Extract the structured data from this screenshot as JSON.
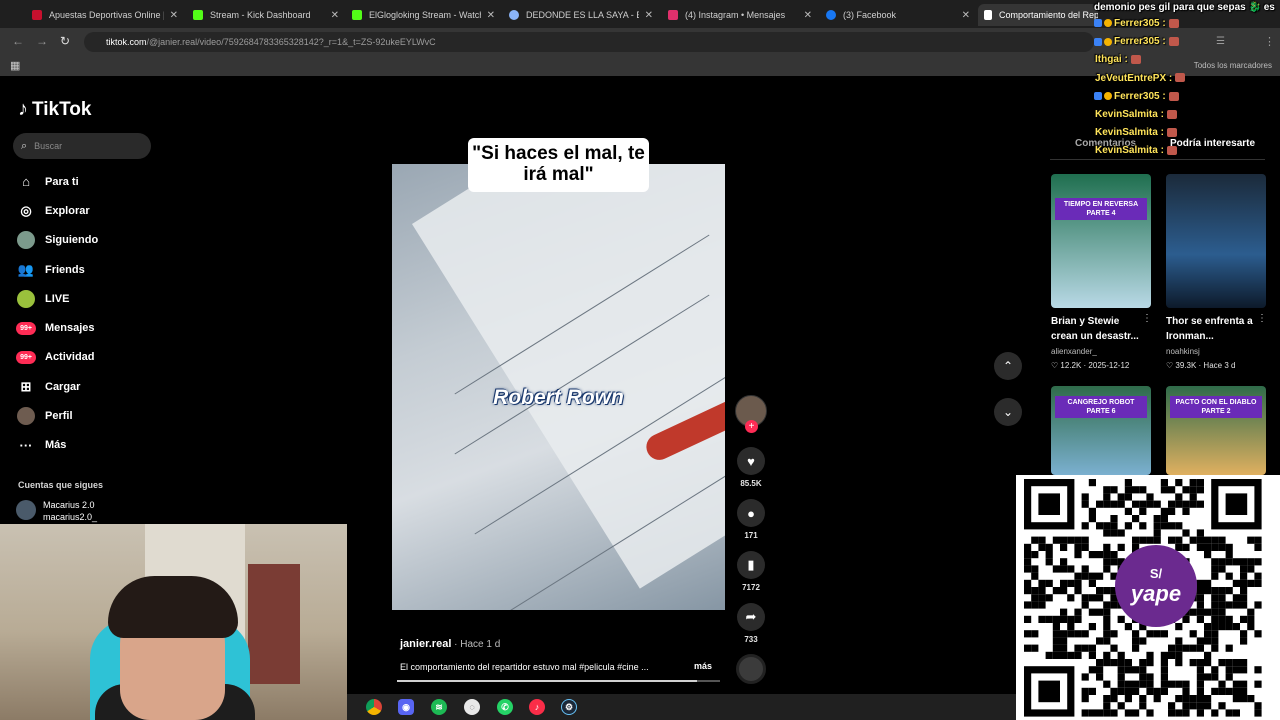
{
  "browser": {
    "tabs": [
      {
        "title": "Apuestas Deportivas Online | Apuestas",
        "color": "#c8102e"
      },
      {
        "title": "Stream - Kick Dashboard",
        "color": "#53fc18"
      },
      {
        "title": "ElGlogloking Stream - Watch Live",
        "color": "#53fc18"
      },
      {
        "title": "DEDONDE ES LLA SAYA - Buscar con Google",
        "color": "#8ab4f8"
      },
      {
        "title": "(4) Instagram • Mensajes",
        "color": "#e1306c"
      },
      {
        "title": "(3) Facebook",
        "color": "#1877f2"
      },
      {
        "title": "Comportamiento del Repartidor",
        "color": "#ffffff"
      }
    ],
    "url_host": "tiktok.com",
    "url_path": "/@janier.real/video/7592684783365328142?_r=1&_t=ZS-92ukeEYLWvC",
    "bookmarks_label": "Todos los marcadores"
  },
  "sidebar": {
    "logo": "TikTok",
    "search_placeholder": "Buscar",
    "items": [
      {
        "label": "Para ti",
        "icon": "home-icon"
      },
      {
        "label": "Explorar",
        "icon": "compass-icon"
      },
      {
        "label": "Siguiendo",
        "icon": "following-avatar"
      },
      {
        "label": "Friends",
        "icon": "friends-icon"
      },
      {
        "label": "LIVE",
        "icon": "live-icon"
      },
      {
        "label": "Mensajes",
        "icon": "messages-badge",
        "badge": "99+"
      },
      {
        "label": "Actividad",
        "icon": "activity-badge",
        "badge": "99+"
      },
      {
        "label": "Cargar",
        "icon": "upload-icon"
      },
      {
        "label": "Perfil",
        "icon": "profile-icon"
      },
      {
        "label": "Más",
        "icon": "more-icon"
      }
    ],
    "following_heading": "Cuentas que sigues",
    "following": [
      {
        "name": "Macarius 2.0",
        "handle": "macarius2.0_"
      }
    ]
  },
  "video": {
    "caption": "\"Si haces el mal, te irá mal\"",
    "name_overlay": "Robert Rown",
    "author": "janier.real",
    "posted": "Hace 1 d",
    "description": "El comportamiento del repartidor estuvo mal #pelicula #cine ...",
    "more_label": "más",
    "likes": "85.5K",
    "comments": "171",
    "saves": "7172",
    "shares": "733",
    "progress": 0.93
  },
  "right_panel": {
    "tabs": [
      "Comentarios",
      "Podría interesarte"
    ],
    "cards": [
      {
        "title": "Brian y Stewie crean un desastr...",
        "user": "alienxander_",
        "likes": "12.2K",
        "date": "2025-12-12",
        "tag": "TIEMPO EN REVERSA PARTE 4"
      },
      {
        "title": "Thor se enfrenta a Ironman...",
        "user": "noahkinsj",
        "likes": "39.3K",
        "date": "Hace 3 d",
        "tag": ""
      },
      {
        "title": "",
        "user": "",
        "likes": "",
        "date": "",
        "tag": "CANGREJO ROBOT PARTE 6"
      },
      {
        "title": "",
        "user": "",
        "likes": "",
        "date": "",
        "tag": "PACTO CON EL DIABLO PARTE 2"
      }
    ]
  },
  "chat": {
    "top_message": "demonio pes gil para que sepas 🐉 es",
    "lines": [
      {
        "user": "Ferrer305 :",
        "yellow": true
      },
      {
        "user": "Ferrer305 :",
        "yellow": true
      },
      {
        "user": "Ithgai :",
        "yellow": true
      },
      {
        "user": "JeVeutEntrePX :",
        "yellow": true
      },
      {
        "user": "Ferrer305 :",
        "yellow": true
      },
      {
        "user": "KevinSalmita :",
        "yellow": true
      },
      {
        "user": "KevinSalmita :",
        "yellow": true
      },
      {
        "user": "KevinSalmita :",
        "yellow": true
      }
    ]
  },
  "qr": {
    "brand": "yape",
    "brand_mark": "S/"
  },
  "taskbar": {
    "apps": [
      "chrome-icon",
      "discord-icon",
      "spotify-icon",
      "obs-icon",
      "whatsapp-icon",
      "music-icon",
      "steam-icon"
    ]
  }
}
